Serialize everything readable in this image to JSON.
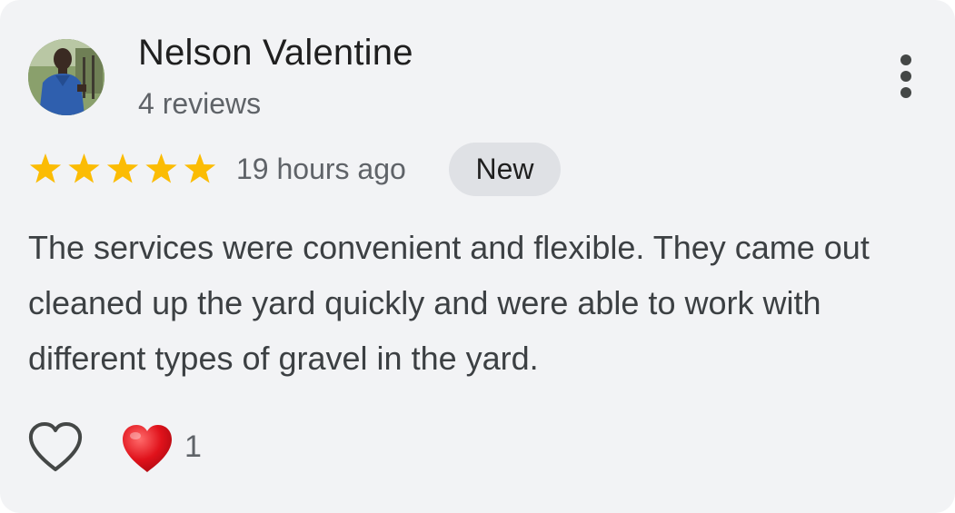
{
  "review": {
    "reviewer_name": "Nelson Valentine",
    "review_count": "4 reviews",
    "rating": 5,
    "rating_max": 5,
    "star_color": "#fbbc04",
    "timestamp": "19 hours ago",
    "badge": "New",
    "text": "The services were convenient and flexible. They came out cleaned up the yard quickly and were able to work with different types of gravel in the yard.",
    "reactions": {
      "heart_count": "1",
      "heart_color": "#e0121b"
    }
  },
  "icons": {
    "avatar": "avatar-photo",
    "more": "more-vert-icon",
    "star": "star-icon",
    "like": "heart-outline-icon",
    "reaction": "heart-filled-icon"
  }
}
